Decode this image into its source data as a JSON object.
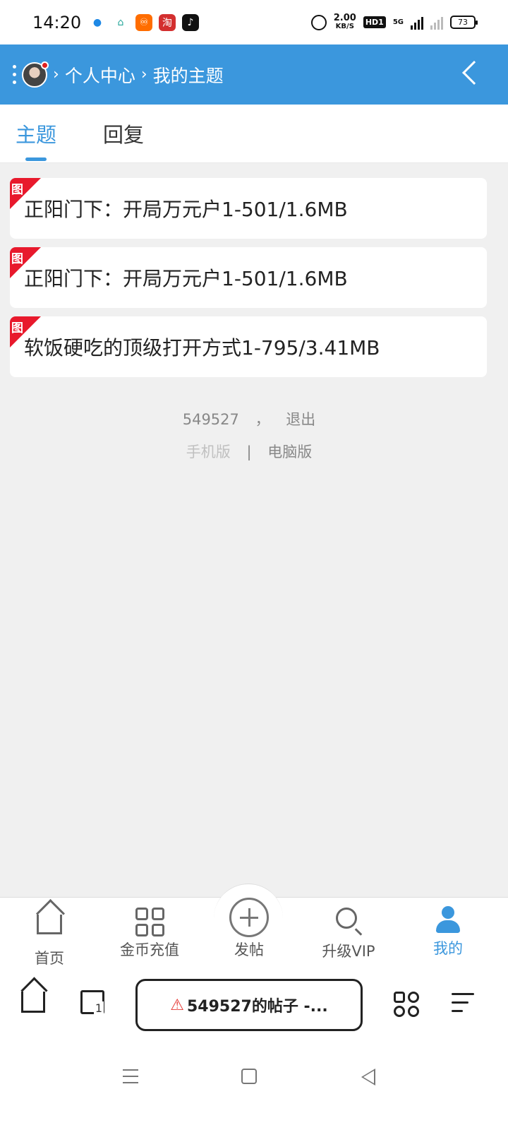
{
  "status_bar": {
    "time": "14:20",
    "net_speed": "2.00",
    "net_unit": "KB/S",
    "hd": "HD1",
    "network": "5G",
    "battery": "73",
    "notif_icons": [
      {
        "name": "app-blue-circle-icon",
        "glyph": "●",
        "color": "#1e88e5"
      },
      {
        "name": "app-home-icon",
        "glyph": "⌂",
        "color": "#26a69a"
      },
      {
        "name": "kuaishou-icon",
        "glyph": "♾",
        "color": "#ff6d00"
      },
      {
        "name": "taobao-icon",
        "glyph": "淘",
        "color": "#d32f2f"
      },
      {
        "name": "tiktok-icon",
        "glyph": "♪",
        "color": "#111111"
      }
    ]
  },
  "header": {
    "breadcrumb": [
      "个人中心",
      "我的主题"
    ],
    "separator": "›",
    "bg_color": "#3b97dd"
  },
  "tabs": [
    {
      "label": "主题",
      "active": true
    },
    {
      "label": "回复",
      "active": false
    }
  ],
  "topics": [
    {
      "tag": "图",
      "title": "正阳门下：开局万元户1-501/1.6MB"
    },
    {
      "tag": "图",
      "title": "正阳门下：开局万元户1-501/1.6MB"
    },
    {
      "tag": "图",
      "title": "软饭硬吃的顶级打开方式1-795/3.41MB"
    }
  ],
  "footer": {
    "username": "549527",
    "comma": "，",
    "logout": "退出",
    "mobile": "手机版",
    "divider": "|",
    "desktop": "电脑版"
  },
  "bottom_nav": [
    {
      "label": "首页",
      "icon": "home-icon"
    },
    {
      "label": "金币充值",
      "icon": "grid-icon"
    },
    {
      "label": "发帖",
      "icon": "plus-circle-icon"
    },
    {
      "label": "升级VIP",
      "icon": "search-icon"
    },
    {
      "label": "我的",
      "icon": "person-icon",
      "active": true
    }
  ],
  "browser": {
    "url_title": "549527的帖子 -...",
    "tab_count": "1"
  }
}
